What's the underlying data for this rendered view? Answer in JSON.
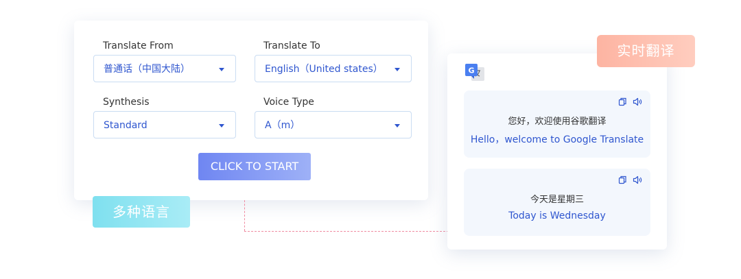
{
  "form": {
    "from_label": "Translate From",
    "from_value": "普通话（中国大陆）",
    "to_label": "Translate To",
    "to_value": "English（United states）",
    "synthesis_label": "Synthesis",
    "synthesis_value": "Standard",
    "voice_label": "Voice Type",
    "voice_value": "A（m）",
    "start_label": "CLICK TO START"
  },
  "badges": {
    "multi_language": "多种语言",
    "realtime": "实时翻译"
  },
  "messages": [
    {
      "source": "您好，欢迎使用谷歌翻译",
      "translation": "Hello，welcome to Google Translate"
    },
    {
      "source": "今天是星期三",
      "translation": "Today is Wednesday"
    }
  ],
  "colors": {
    "accent_blue": "#2f56cf",
    "button_gradient_start": "#6f86f2",
    "teal_badge": "#7fe0ef",
    "salmon_badge": "#fdb4a2",
    "connector": "#f08aa0"
  },
  "icons": {
    "translate_app": "google-translate-icon",
    "copy": "copy-icon",
    "speaker": "speaker-icon",
    "dropdown": "caret-down-icon"
  }
}
